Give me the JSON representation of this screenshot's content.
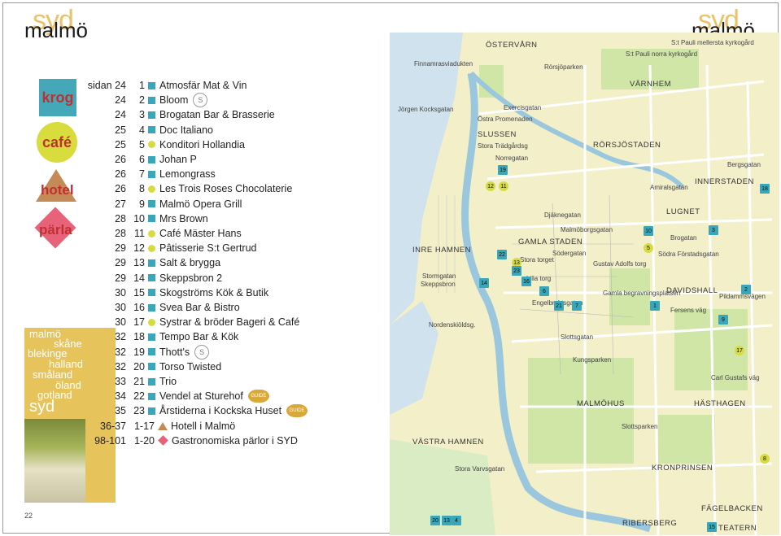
{
  "brand": {
    "top": "syd",
    "bottom": "malmö"
  },
  "categories": {
    "krog": "krog",
    "cafe": "café",
    "hotel": "hotel",
    "parla": "pärla"
  },
  "regions": [
    "malmö",
    "skåne",
    "blekinge",
    "halland",
    "småland",
    "öland",
    "gotland",
    "syd"
  ],
  "listing": [
    {
      "page": "sidan 24",
      "num": "1",
      "type": "krog",
      "name": "Atmosfär Mat & Vin"
    },
    {
      "page": "24",
      "num": "2",
      "type": "krog",
      "name": "Bloom",
      "badge": "S"
    },
    {
      "page": "24",
      "num": "3",
      "type": "krog",
      "name": "Brogatan Bar & Brasserie"
    },
    {
      "page": "25",
      "num": "4",
      "type": "krog",
      "name": "Doc Italiano"
    },
    {
      "page": "25",
      "num": "5",
      "type": "cafe",
      "name": "Konditori Hollandia"
    },
    {
      "page": "26",
      "num": "6",
      "type": "krog",
      "name": "Johan P"
    },
    {
      "page": "26",
      "num": "7",
      "type": "krog",
      "name": "Lemongrass"
    },
    {
      "page": "26",
      "num": "8",
      "type": "cafe",
      "name": "Les Trois Roses Chocolaterie"
    },
    {
      "page": "27",
      "num": "9",
      "type": "krog",
      "name": "Malmö Opera Grill"
    },
    {
      "page": "28",
      "num": "10",
      "type": "krog",
      "name": "Mrs Brown"
    },
    {
      "page": "28",
      "num": "11",
      "type": "cafe",
      "name": "Café Mäster Hans"
    },
    {
      "page": "29",
      "num": "12",
      "type": "cafe",
      "name": "Pâtisserie S:t Gertrud"
    },
    {
      "page": "29",
      "num": "13",
      "type": "krog",
      "name": "Salt & brygga"
    },
    {
      "page": "29",
      "num": "14",
      "type": "krog",
      "name": "Skeppsbron 2"
    },
    {
      "page": "30",
      "num": "15",
      "type": "krog",
      "name": "Skogströms Kök & Butik"
    },
    {
      "page": "30",
      "num": "16",
      "type": "krog",
      "name": "Svea Bar & Bistro"
    },
    {
      "page": "30",
      "num": "17",
      "type": "cafe",
      "name": "Systrar & bröder Bageri & Café"
    },
    {
      "page": "32",
      "num": "18",
      "type": "krog",
      "name": "Tempo Bar & Kök"
    },
    {
      "page": "32",
      "num": "19",
      "type": "krog",
      "name": "Thott's",
      "badge": "S"
    },
    {
      "page": "32",
      "num": "20",
      "type": "krog",
      "name": "Torso Twisted"
    },
    {
      "page": "33",
      "num": "21",
      "type": "krog",
      "name": "Trio"
    },
    {
      "page": "34",
      "num": "22",
      "type": "krog",
      "name": "Vendel at Sturehof",
      "guide": "GUIDE"
    },
    {
      "page": "35",
      "num": "23",
      "type": "krog",
      "name": "Årstiderna i Kockska Huset",
      "guide": "GUIDE"
    },
    {
      "page": "36-37",
      "num": "1-17",
      "type": "hotel",
      "name": "Hotell i Malmö"
    },
    {
      "page": "98-101",
      "num": "1-20",
      "type": "parla",
      "name": "Gastronomiska pärlor i SYD"
    }
  ],
  "page_number": "22",
  "map": {
    "districts": [
      "ÖSTERVÅRN",
      "VÄRNHEM",
      "SLUSSEN",
      "RÖRSJÖSTADEN",
      "INNERSTADEN",
      "INRE HAMNEN",
      "GAMLA STADEN",
      "LUGNET",
      "DAVIDSHALL",
      "VÄSTRA HAMNEN",
      "MALMÖHUS",
      "HÄSTHAGEN",
      "KRONPRINSEN",
      "FÄGELBACKEN",
      "RIBERSBERG",
      "TEATERN"
    ],
    "streets": [
      "Exercisgatan",
      "Östra Promenaden",
      "Stora Trädgårdsg",
      "Norregatan",
      "Djäknegatan",
      "Malmöborgsgatan",
      "Södergatan",
      "Stora torget",
      "Lilla torg",
      "Engelbrektsgatan",
      "Slottsgatan",
      "Kungsparken",
      "Slottsparken",
      "Södra Förstadsgatan",
      "Fersens väg",
      "Pildammsvägen",
      "Bergsgatan",
      "Amiralsgatan",
      "Brogatan",
      "Stora Varvsgatan",
      "Skeppsbron",
      "Stormgatan",
      "Nordenskiöldsg.",
      "Carl Gustafs väg",
      "Gustav Adolfs torg",
      "Gamla begravningsplatsen",
      "S:t Pauli norra kyrkogård",
      "S:t Pauli mellersta kyrkogård",
      "Rörsjöparken",
      "Finnamrasviadukten",
      "Jörgen Kocksgatan"
    ],
    "markers": [
      {
        "n": "19",
        "k": "sq"
      },
      {
        "n": "12",
        "k": "y"
      },
      {
        "n": "11",
        "k": "y"
      },
      {
        "n": "22",
        "k": "sq"
      },
      {
        "n": "13",
        "k": "y"
      },
      {
        "n": "23",
        "k": "sq"
      },
      {
        "n": "16",
        "k": "sq"
      },
      {
        "n": "14",
        "k": "sq"
      },
      {
        "n": "6",
        "k": "sq"
      },
      {
        "n": "21",
        "k": "sq"
      },
      {
        "n": "7",
        "k": "sq"
      },
      {
        "n": "10",
        "k": "sq"
      },
      {
        "n": "5",
        "k": "y"
      },
      {
        "n": "3",
        "k": "sq"
      },
      {
        "n": "1",
        "k": "sq"
      },
      {
        "n": "9",
        "k": "sq"
      },
      {
        "n": "2",
        "k": "sq"
      },
      {
        "n": "17",
        "k": "y"
      },
      {
        "n": "18",
        "k": "sq"
      },
      {
        "n": "8",
        "k": "y"
      },
      {
        "n": "15",
        "k": "sq"
      },
      {
        "n": "20",
        "k": "sq"
      },
      {
        "n": "13",
        "k": "sq"
      },
      {
        "n": "4",
        "k": "sq"
      }
    ]
  }
}
